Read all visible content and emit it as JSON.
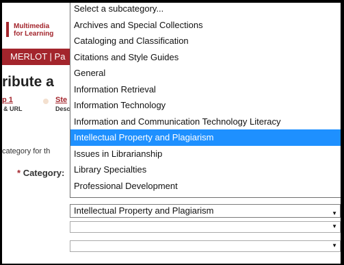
{
  "background": {
    "logo_line1": "Multimedia",
    "logo_line2": "for Learning",
    "banner_text": "MERLOT | Pa",
    "heading": "ribute a",
    "step1_label": "p 1",
    "step1_sub": "& URL",
    "step2_label": "Ste",
    "step2_sub": "Desc",
    "category_hint": "category for th",
    "category_label": "Category:",
    "required_mark": "*"
  },
  "dropdown": {
    "options": [
      "Select a subcategory...",
      "Archives and Special Collections",
      "Cataloging and Classification",
      "Citations and Style Guides",
      "General",
      "Information Retrieval",
      "Information Technology",
      "Information and Communication Technology Literacy",
      "Intellectual Property and Plagiarism",
      "Issues in Librarianship",
      "Library Specialties",
      "Professional Development"
    ],
    "highlighted_index": 8
  },
  "select": {
    "value": "Intellectual Property and Plagiarism",
    "arrow": "▼"
  },
  "empty_selects": [
    {
      "value": "",
      "arrow": "▼"
    },
    {
      "value": "",
      "arrow": "▼"
    }
  ],
  "colors": {
    "brand": "#a3252c",
    "highlight": "#1e90ff"
  }
}
